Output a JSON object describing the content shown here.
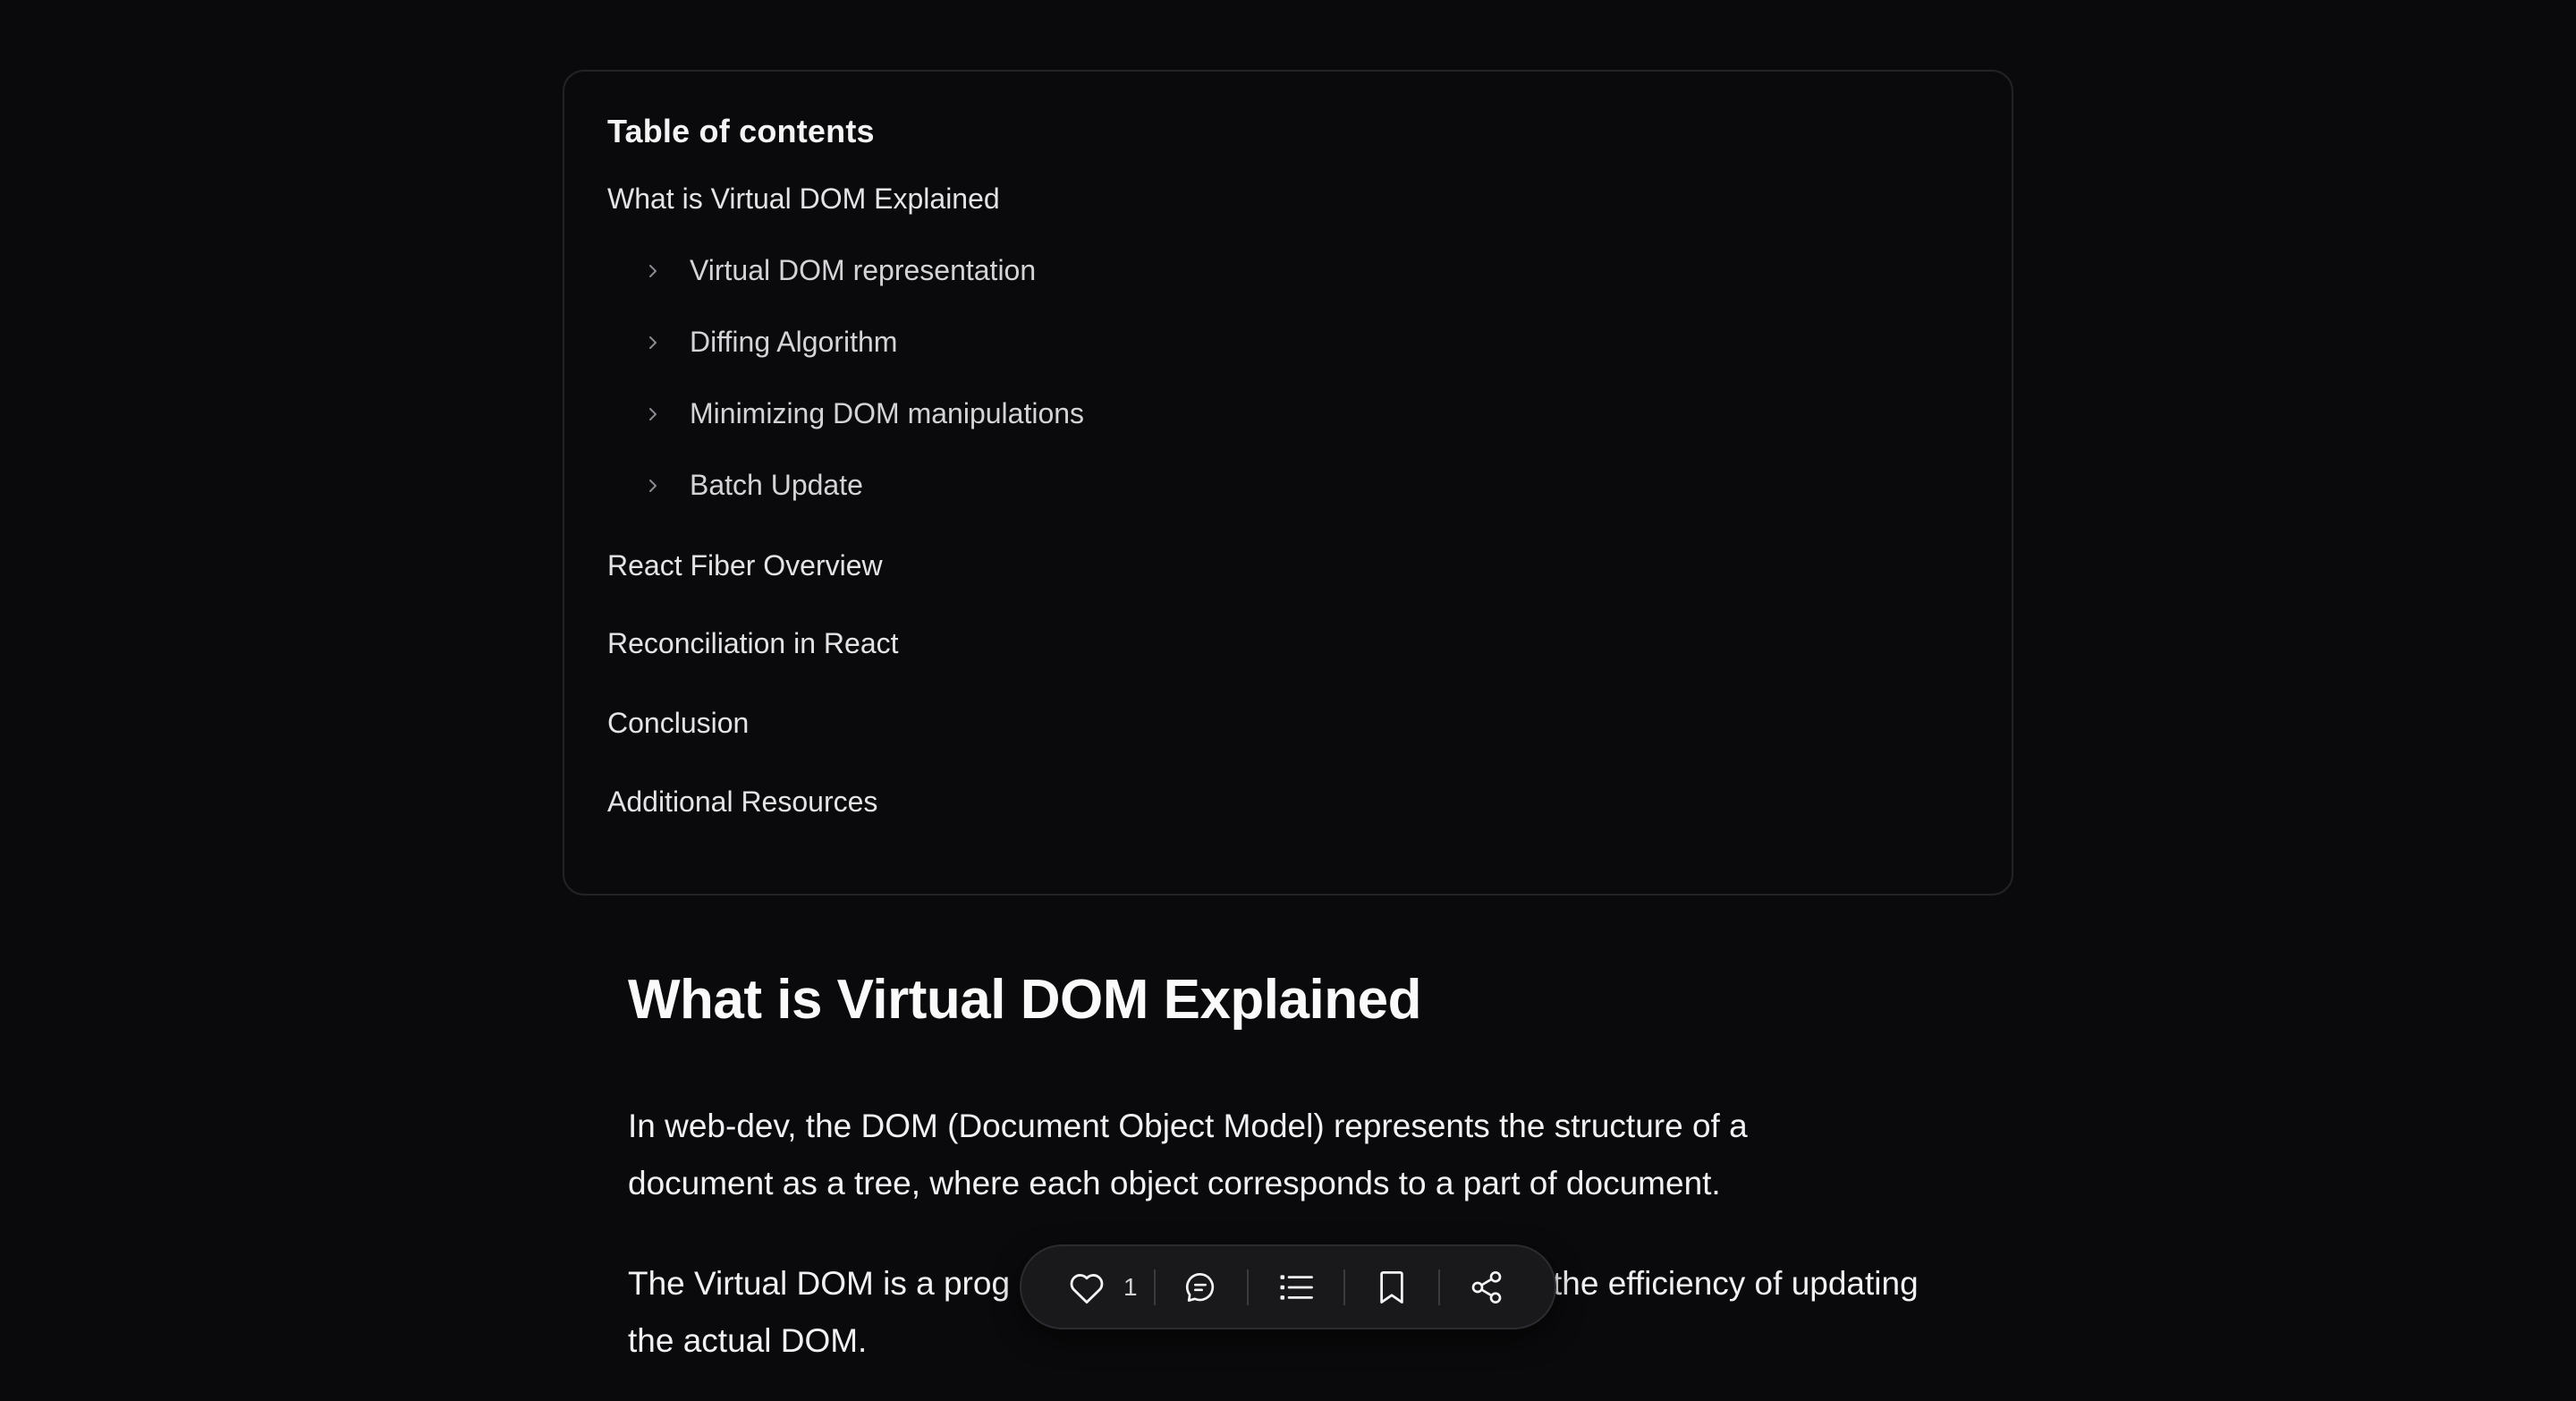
{
  "toc": {
    "title": "Table of contents",
    "items": [
      {
        "label": "What is Virtual DOM Explained",
        "level": 1
      },
      {
        "label": "Virtual DOM representation",
        "level": 2
      },
      {
        "label": "Diffing Algorithm",
        "level": 2
      },
      {
        "label": "Minimizing DOM manipulations",
        "level": 2
      },
      {
        "label": "Batch Update",
        "level": 2
      },
      {
        "label": "React Fiber Overview",
        "level": 1
      },
      {
        "label": "Reconciliation in React",
        "level": 1
      },
      {
        "label": "Conclusion",
        "level": 1
      },
      {
        "label": "Additional Resources",
        "level": 1
      }
    ],
    "sub_icon": "chevron-right-icon"
  },
  "article": {
    "heading": "What is Virtual DOM Explained",
    "paragraph1": {
      "line1": "In web-dev, the DOM (Document Object Model) represents the structure of a",
      "line2": "document as a tree, where each object corresponds to a part of document."
    },
    "paragraph2": {
      "line1_visible_start": "The Virtual DOM is a prog",
      "line1_visible_end": "the efficiency of updating",
      "line2": "the actual DOM."
    }
  },
  "action_bar": {
    "like": {
      "icon": "heart-icon",
      "count": "1"
    },
    "comment": {
      "icon": "comment-icon"
    },
    "toc": {
      "icon": "list-icon"
    },
    "bookmark": {
      "icon": "bookmark-icon"
    },
    "share": {
      "icon": "share-icon"
    }
  },
  "colors": {
    "background": "#0a0a0c",
    "card_border": "#232326",
    "action_bar_bg": "#19191c",
    "text_primary": "#f4f4f5"
  }
}
